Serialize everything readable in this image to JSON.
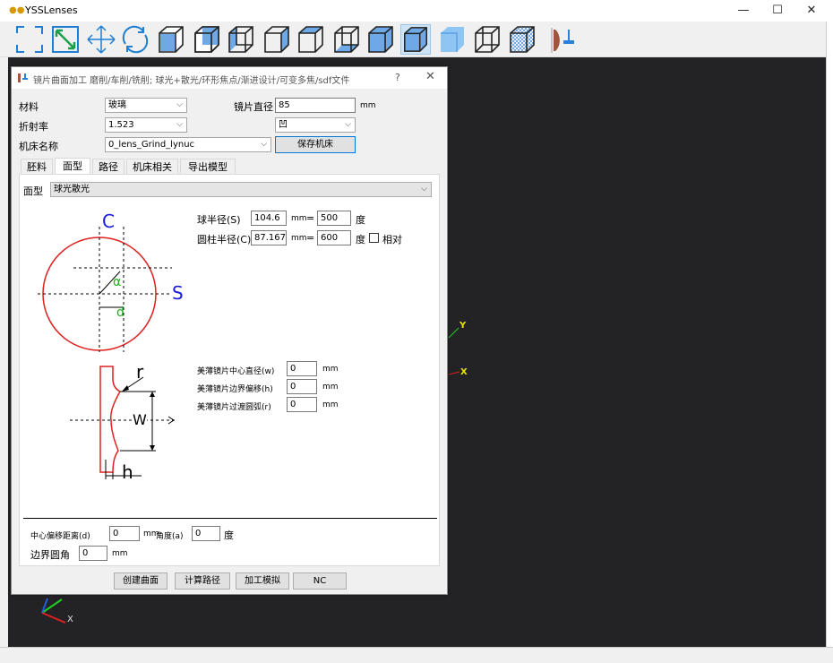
{
  "app": {
    "title": "YSSLenses",
    "minimize": "—",
    "maximize": "☐",
    "close": "✕"
  },
  "toolbar": {
    "icons": [
      "select-box-icon",
      "zoom-fit-icon",
      "pan-icon",
      "rotate-icon",
      "view-front-icon",
      "view-back-icon",
      "view-left-icon",
      "view-right-icon",
      "view-top-icon",
      "view-bottom-icon",
      "view-iso-icon",
      "shaded-icon",
      "shaded-edges-icon",
      "wireframe-icon",
      "hidden-line-icon",
      "lens-tool-icon"
    ]
  },
  "dialog": {
    "title": "镜片曲面加工  磨削/车削/铣削; 球光+散光/环形焦点/渐进设计/可变多焦/sdf文件",
    "help": "?",
    "close": "✕",
    "material_label": "材料",
    "material_value": "玻璃",
    "lens_diameter_label": "镜片直径",
    "lens_diameter_value": "85",
    "lens_diameter_unit": "mm",
    "refractive_label": "折射率",
    "refractive_value": "1.523",
    "shape_value": "凹",
    "machine_label": "机床名称",
    "machine_value": "0_lens_Grind_lynuc",
    "save_machine": "保存机床",
    "tabs": [
      "胚料",
      "面型",
      "路径",
      "机床相关",
      "导出模型"
    ],
    "surface_label": "面型",
    "surface_value": "球光散光",
    "sphere_radius_label": "球半径(S)",
    "sphere_radius_value": "104.6",
    "sphere_unit": "mm",
    "sphere_eq": "=",
    "sphere_deg_value": "500",
    "deg_unit": "度",
    "cyl_radius_label": "圆柱半径(C)",
    "cyl_radius_value": "87.167",
    "cyl_unit": "mm",
    "cyl_eq": "=",
    "cyl_deg_value": "600",
    "relative_label": "相对",
    "diagram1": {
      "c": "C",
      "s": "S",
      "alpha": "α",
      "d": "d"
    },
    "diagram2": {
      "r": "r",
      "w": "W",
      "h": "h"
    },
    "thin_center_label": "美薄镜片中心直径(w)",
    "thin_center_value": "0",
    "thin_offset_label": "美薄镜片边界偏移(h)",
    "thin_offset_value": "0",
    "thin_fillet_label": "美薄镜片过渡圆弧(r)",
    "thin_fillet_value": "0",
    "mm": "mm",
    "center_offset_label": "中心偏移距离(d)",
    "center_offset_value": "0",
    "angle_label": "角度(a)",
    "angle_value": "0",
    "edge_fillet_label": "边界圆角",
    "edge_fillet_value": "0",
    "buttons": {
      "create": "创建曲面",
      "compute": "计算路径",
      "simulate": "加工模拟",
      "nc": "NC"
    }
  },
  "viewport": {
    "axis_y": "Y",
    "axis_x": "X",
    "corner_x": "X"
  },
  "colors": {
    "accent": "#1e7fd2",
    "viewport": "#232326",
    "diagram_red": "#e02020",
    "diagram_green": "#22aa22",
    "diagram_blue": "#1a1adb"
  }
}
